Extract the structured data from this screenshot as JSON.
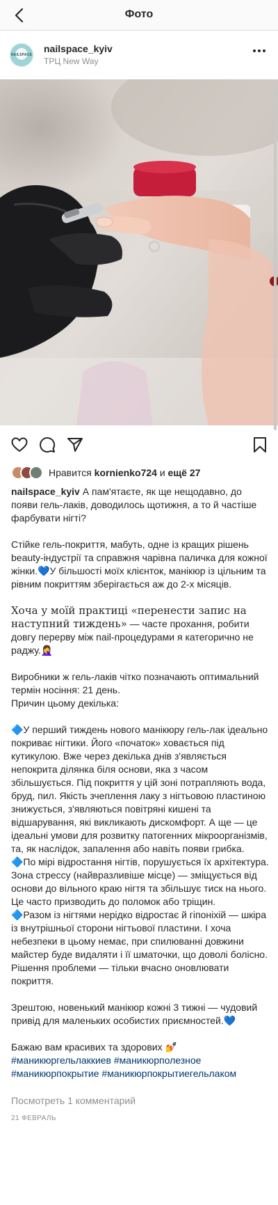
{
  "topbar": {
    "title": "Фото",
    "back_icon": "chevron-left-icon"
  },
  "post": {
    "avatar_text": "NAILSPACE",
    "username": "nailspace_kyiv",
    "location": "ТРЦ New Way",
    "more_icon": "more-horizontal-icon"
  },
  "actions": {
    "like_icon": "heart-icon",
    "comment_icon": "comment-icon",
    "share_icon": "paper-plane-icon",
    "save_icon": "bookmark-icon"
  },
  "likes": {
    "prefix": "Нравится",
    "user": "kornienko724",
    "middle": "и",
    "others": "ещё 27"
  },
  "caption": {
    "username": "nailspace_kyiv",
    "p1": "А пам'ятаєте, як ще нещодавно, до появи гель-лаків, доводилось щотижня, а то й частіше фарбувати нігті?",
    "p2": "Стійке гель-покриття, мабуть, одне із кращих рішень beauty-індустрії та справжня чарівна паличка для кожної жінки.💙У більшості моїх клієнток, манікюр із цільним та рівним покриттям зберігається аж до 2-х місяців.",
    "p3a": "Хоча у моїй практиці «перенести запис на наступний тиждень»",
    "p3b": " — часте прохання, робити довгу перерву між nail-процедурами я категорично не раджу.🤦‍♀️",
    "p4": "Виробники ж гель-лаків чітко позначають оптимальний термін носіння: 21 день.",
    "p5": "Причин цьому декілька:",
    "p6": "🔷У перший тиждень нового манікюру гель-лак ідеально покриває нігтики. Його «початок» ховається під кутикулою. Вже через декілька днів з'являється непокрита ділянка біля основи, яка з часом збільшується. Під покриття у цій зоні потрапляють вода, бруд, пил. Якість зчеплення лаку з нігтьовою пластиною знижується, з'являються повітряні кишені та відшарування, які викликають дискомфорт. А ще — це ідеальні умови для розвитку патогенних мікроорганізмів, та, як наслідок, запалення або навіть появи грибка.",
    "p7": "🔷По мірі відростання нігтів, порушується їх архітектура. Зона стрессу (найвразливіше місце) — зміщується від основи до вільного краю нігтя та збільшує тиск на нього. Це часто призводить до поломок або тріщин.",
    "p8": "🔷Разом із нігтями нерідко відростає й гіпоніхій — шкіра із внутрішньої сторони нігтьової пластини. І хоча небезпеки в цьому немає, при спилюванні довжини майстер буде видаляти і її шматочки, що доволі болісно. Рішення проблеми — тільки вчасно оновлювати покриття.",
    "p9": "Зрештою, новенький манікюр кожні 3 тижні — чудовий привід для маленьких особистих приємностей.💙",
    "p10": "Бажаю вам красивих та здорових 💅",
    "hashtags1": "#маникюргельлаккиев #маникюрполезное",
    "hashtags2": "#маникюрпокрытие #маникюрпокрытиегельлаком"
  },
  "comments_link": "Посмотреть 1 комментарий",
  "date": "21 ФЕВРАЛЬ"
}
